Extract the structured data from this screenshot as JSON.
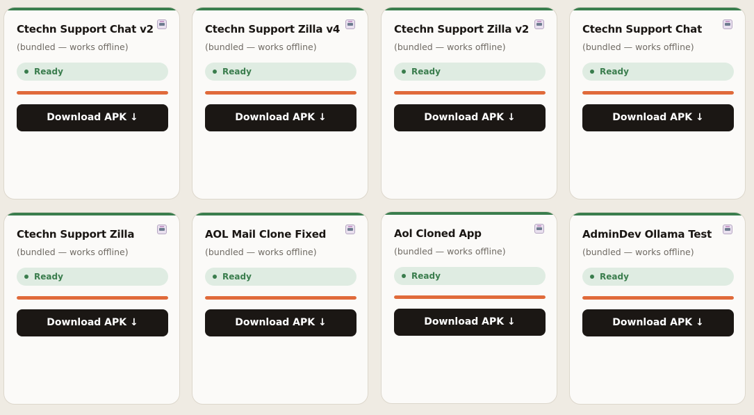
{
  "cards": [
    {
      "title": "Ctechn Support Chat v2",
      "subtitle": "(bundled — works offline)",
      "status": "Ready",
      "button": "Download APK ↓",
      "progress": 1.0
    },
    {
      "title": "Ctechn Support Zilla v4",
      "subtitle": "(bundled — works offline)",
      "status": "Ready",
      "button": "Download APK ↓",
      "progress": 1.0
    },
    {
      "title": "Ctechn Support Zilla v2",
      "subtitle": "(bundled — works offline)",
      "status": "Ready",
      "button": "Download APK ↓",
      "progress": 1.0
    },
    {
      "title": "Ctechn Support Chat",
      "subtitle": "(bundled — works offline)",
      "status": "Ready",
      "button": "Download APK ↓",
      "progress": 1.0
    },
    {
      "title": "Ctechn Support Zilla",
      "subtitle": "(bundled — works offline)",
      "status": "Ready",
      "button": "Download APK ↓",
      "progress": 1.0
    },
    {
      "title": "AOL Mail Clone Fixed",
      "subtitle": "(bundled — works offline)",
      "status": "Ready",
      "button": "Download APK ↓",
      "progress": 1.0
    },
    {
      "title": "Aol Cloned App",
      "subtitle": "(bundled — works offline)",
      "status": "Ready",
      "button": "Download APK ↓",
      "progress": 1.0
    },
    {
      "title": "AdminDev Ollama Test",
      "subtitle": "(bundled — works offline)",
      "status": "Ready",
      "button": "Download APK ↓",
      "progress": 1.0
    }
  ],
  "colors": {
    "accent_green": "#3a7d4d",
    "progress_orange": "#e06a3a",
    "button_dark": "#1b1714",
    "status_bg": "#dfece2"
  },
  "icons": {
    "card_icon": "app-robot-icon",
    "status_icon": "status-dot-icon"
  }
}
